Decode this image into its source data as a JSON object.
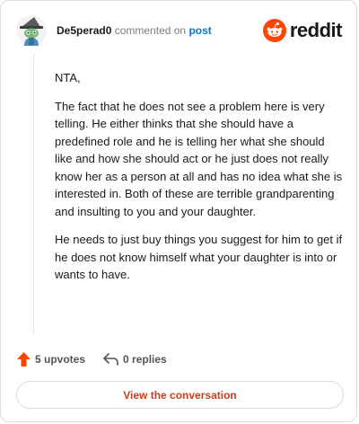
{
  "comment": {
    "username": "De5perad0",
    "commented_on_text": "commented on",
    "post_link": "post",
    "paragraphs": [
      "NTA,",
      "The fact that he does not see a problem here is very telling. He either thinks that she should have a predefined role and he is telling her what she should like and how she should act or he just does not really know her as a person at all and has no idea what she is interested in. Both of these are terrible grandparenting and insulting to you and your daughter.",
      "He needs to just buy things you suggest for him to get if he does not know himself what your daughter is into or wants to have."
    ]
  },
  "brand": {
    "name": "reddit",
    "icon": "reddit-snoo-icon",
    "color": "#ff4500"
  },
  "actions": {
    "upvotes_label": "5 upvotes",
    "upvote_icon": "upvote-arrow-icon",
    "upvote_color": "#ff4500",
    "replies_label": "0 replies",
    "reply_icon": "reply-arrow-icon"
  },
  "footer": {
    "view_conversation_label": "View the conversation",
    "accent_color": "#c5401e"
  }
}
